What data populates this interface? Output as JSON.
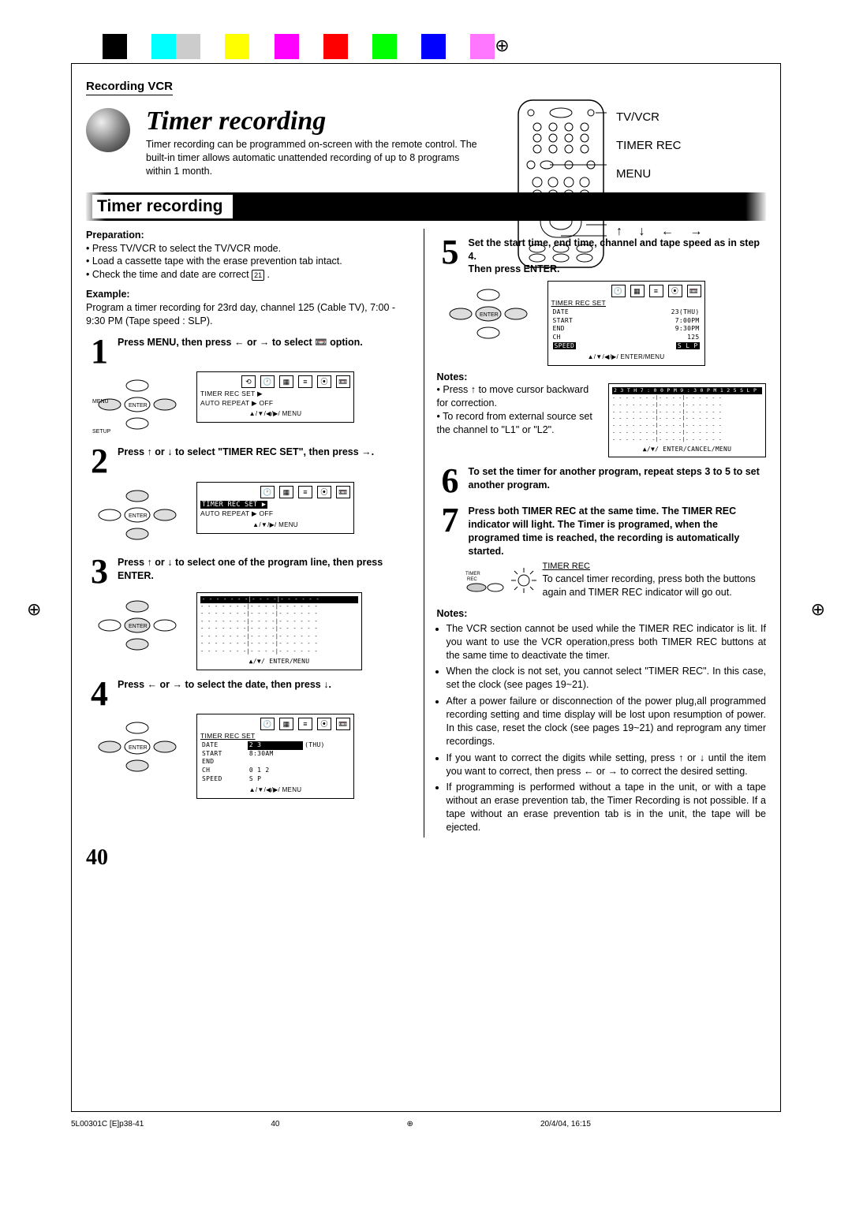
{
  "print": {
    "colors": [
      "#000",
      "#fff",
      "#0ff",
      "#ccc",
      "#fff",
      "#ff0",
      "#fff",
      "#f0f",
      "#fff",
      "#f00",
      "#fff",
      "#0f0",
      "#fff",
      "#00f",
      "#fff",
      "#f7f",
      "#fff"
    ]
  },
  "header": {
    "section_label": "Recording VCR"
  },
  "title": {
    "heading": "Timer recording",
    "intro": "Timer recording can be programmed on-screen with the remote control. The built-in timer allows automatic unattended recording of up to 8 programs within 1 month."
  },
  "remote": {
    "labels": [
      "TV/VCR",
      "TIMER REC",
      "MENU",
      "ENTER"
    ],
    "arrows": "↑ ↓ ← →"
  },
  "bar": {
    "title": "Timer recording"
  },
  "left": {
    "prep_heading": "Preparation:",
    "prep_items": [
      "Press TV/VCR to select the TV/VCR mode.",
      "Load a cassette tape with the erase prevention tab intact.",
      "Check the time and date are correct"
    ],
    "page_ref": "21",
    "example_heading": "Example:",
    "example_text": "Program a timer recording for 23rd day, channel 125 (Cable TV), 7:00 - 9:30 PM (Tape speed : SLP).",
    "step1": "Press MENU, then press ← or → to select 📼 option.",
    "step2": "Press ↑ or ↓ to select \"TIMER REC SET\", then press →.",
    "step3": "Press ↑ or ↓ to select one of the program line, then press ENTER.",
    "step4": "Press ← or → to select the date, then press ↓.",
    "osd1": {
      "l1": "TIMER  REC  SET          ▶",
      "l2": "AUTO  REPEAT           ▶ OFF",
      "footer": "▲/▼/◀/▶/ MENU"
    },
    "osd2": {
      "l1": "TIMER  REC  SET          ▶",
      "l2": "AUTO  REPEAT           ▶ OFF",
      "footer": "▲/▼/▶/ MENU"
    },
    "osd3": {
      "rows": [
        "- - - - -   - -|- -   - -|- -   - - -   -",
        "- - - - -   - -|- -   - -|- -   - - -   -",
        "- - - - -   - -|- -   - -|- -   - - -   -",
        "- - - - -   - -|- -   - -|- -   - - -   -",
        "- - - - -   - -|- -   - -|- -   - - -   -",
        "- - - - -   - -|- -   - -|- -   - - -   -",
        "- - - - -   - -|- -   - -|- -   - - -   -",
        "- - - - -   - -|- -   - -|- -   - - -   -"
      ],
      "footer": "▲/▼/ ENTER/MENU"
    },
    "osd4": {
      "title": "TIMER  REC  SET",
      "rows": [
        [
          "DATE",
          "2 3",
          "(THU)"
        ],
        [
          "START",
          "8:30AM",
          ""
        ],
        [
          "END",
          "",
          ""
        ],
        [
          "CH",
          "0 1 2",
          ""
        ],
        [
          "SPEED",
          "S P",
          ""
        ]
      ],
      "footer": "▲/▼/◀/▶/ MENU"
    },
    "dpad": {
      "menu": "MENU",
      "setup": "SETUP",
      "enter": "ENTER"
    }
  },
  "right": {
    "step5": "Set the start time, end time, channel and tape speed as in step 4.\nThen press ENTER.",
    "step6": "To set the timer for another program, repeat steps 3 to 5 to set another program.",
    "step7": "Press both TIMER REC at the same time. The TIMER REC indicator will light. The Timer is programed, when the programed time is reached, the recording is automatically started.",
    "notes_heading": "Notes:",
    "notes1": [
      "Press ↑ to move cursor backward for correction.",
      "To record from external source set the channel to \"L1\" or \"L2\"."
    ],
    "timer_label": "TIMER REC",
    "timer_sub": "TIMER\nREC",
    "cancel_text": "To cancel timer recording, press both the buttons again and TIMER REC indicator will go out.",
    "osd5": {
      "title": "TIMER  REC  SET",
      "rows": [
        [
          "DATE",
          "23(THU)"
        ],
        [
          "START",
          "7:00PM"
        ],
        [
          "END",
          "9:30PM"
        ],
        [
          "CH",
          "125"
        ]
      ],
      "speed_label": "SPEED",
      "speed_val": "S L P",
      "footer": "▲/▼/◀/▶/ ENTER/MENU"
    },
    "osd6": {
      "header": "2 3  T H  7 : 0 0 P M  9 : 3 0 P M 1 2 5  S L P",
      "rows": [
        "- - - - -   - -|- -   - -|- -   - - -   -",
        "- - - - -   - -|- -   - -|- -   - - -   -",
        "- - - - -   - -|- -   - -|- -   - - -   -",
        "- - - - -   - -|- -   - -|- -   - - -   -",
        "- - - - -   - -|- -   - -|- -   - - -   -",
        "- - - - -   - -|- -   - -|- -   - - -   -",
        "- - - - -   - -|- -   - -|- -   - - -   -"
      ],
      "footer": "▲/▼/ ENTER/CANCEL/MENU"
    },
    "notes2_heading": "Notes:",
    "notes2": [
      "The VCR section cannot be used while the TIMER REC indicator is lit. If you want to use the VCR operation,press both TIMER REC buttons at the same time to deactivate the timer.",
      "When the clock is not set, you cannot select \"TIMER REC\". In this case, set the clock (see pages 19~21).",
      "After a power failure or disconnection of the power plug,all programmed recording setting and time display will be  lost upon resumption of power. In this case, reset the clock (see pages 19~21) and reprogram any timer recordings.",
      "If you want to correct the digits while setting, press ↑ or ↓ until the item you want to correct, then press ← or → to correct the desired setting.",
      "If programming is performed without a tape in the unit, or with a tape without an erase prevention tab, the Timer Recording is not possible. If a tape without an erase prevention tab is in the unit, the tape will be ejected."
    ]
  },
  "page": {
    "number": "40"
  },
  "footer": {
    "docid": "5L00301C [E]p38-41",
    "page": "40",
    "date": "20/4/04, 16:15"
  }
}
